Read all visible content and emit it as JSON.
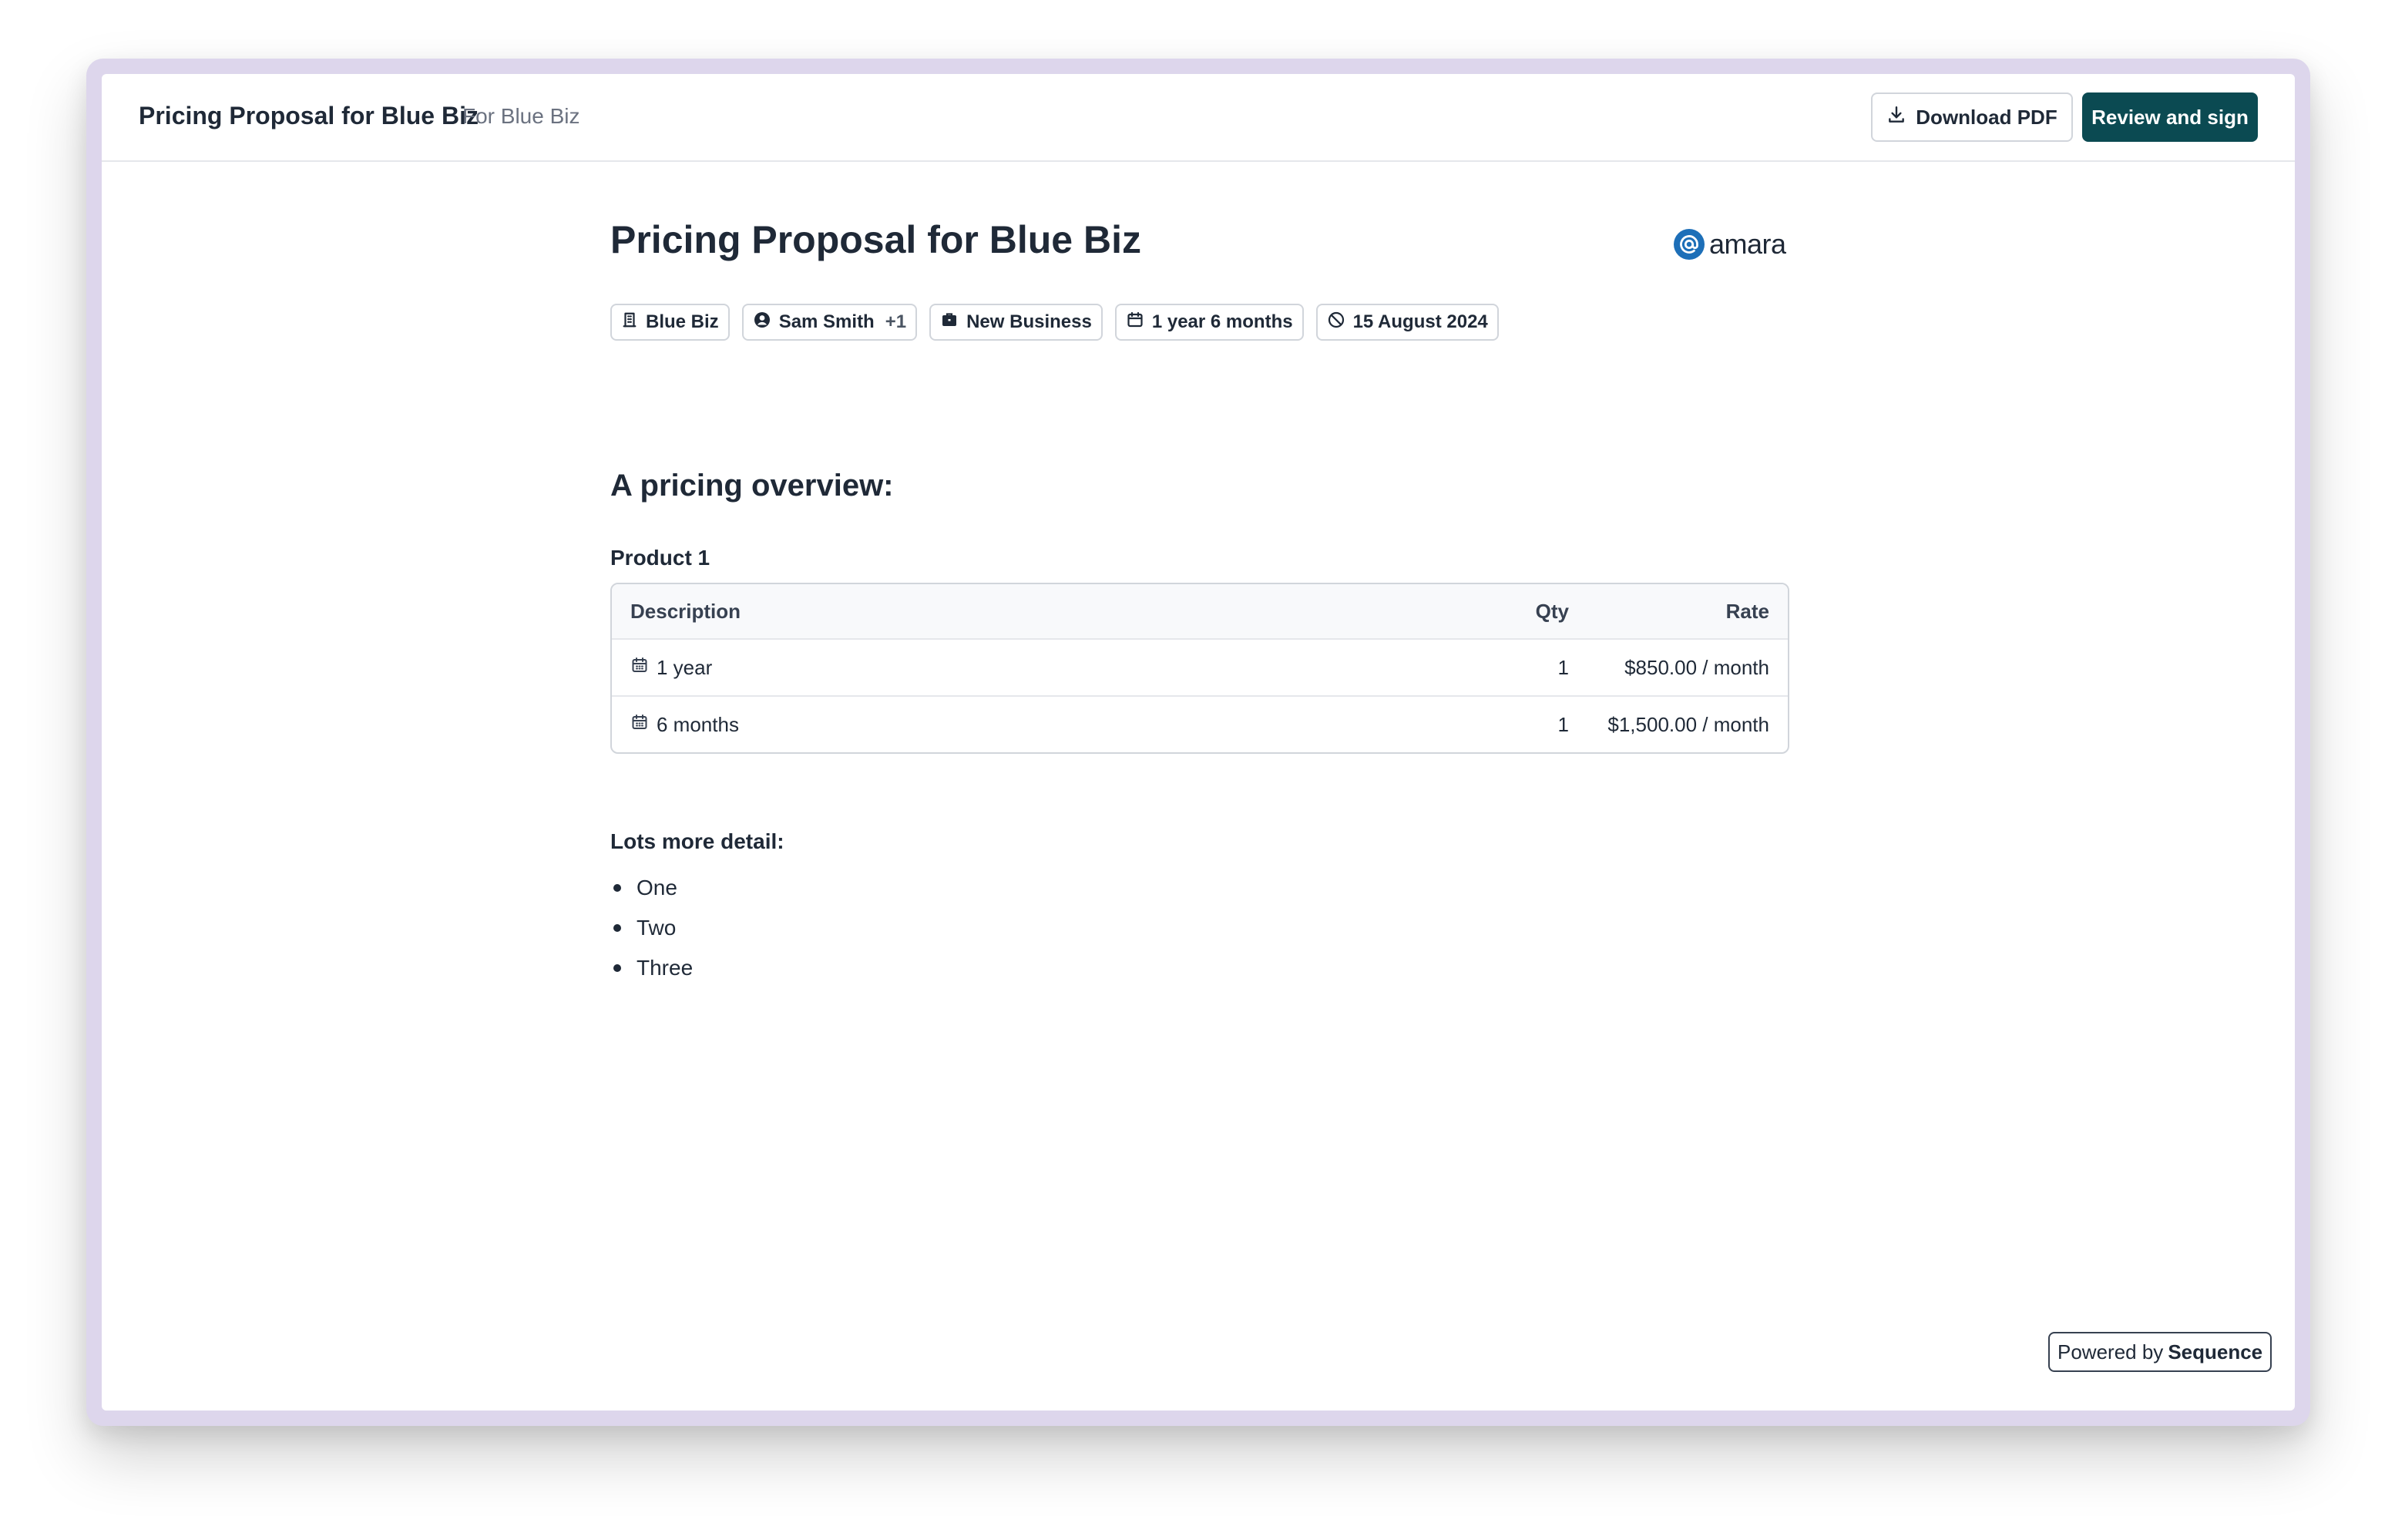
{
  "topbar": {
    "title": "Pricing Proposal for Blue Biz",
    "subtitle": "For Blue Biz",
    "download_label": "Download PDF",
    "review_label": "Review and sign"
  },
  "document": {
    "title": "Pricing Proposal for Blue Biz",
    "logo_text": "amara",
    "tags": {
      "company": "Blue Biz",
      "owner": "Sam Smith",
      "owner_extra": "+1",
      "deal_type": "New Business",
      "duration": "1 year 6 months",
      "expiry": "15 August 2024"
    },
    "section_title": "A pricing overview:",
    "product_title": "Product 1",
    "table": {
      "headers": {
        "description": "Description",
        "qty": "Qty",
        "rate": "Rate"
      },
      "rows": [
        {
          "description": "1 year",
          "qty": "1",
          "rate": "$850.00 / month"
        },
        {
          "description": "6 months",
          "qty": "1",
          "rate": "$1,500.00 / month"
        }
      ]
    },
    "detail_title": "Lots more detail:",
    "bullets": [
      "One",
      "Two",
      "Three"
    ]
  },
  "footer": {
    "powered_by": "Powered by",
    "brand": "Sequence"
  },
  "colors": {
    "primary": "#0b4a52",
    "frame": "#ddd6ec",
    "logo": "#1d6fb8"
  },
  "icons": [
    "download-icon",
    "building-icon",
    "user-circle-icon",
    "briefcase-icon",
    "calendar-icon",
    "ban-icon",
    "calendar-days-icon"
  ]
}
